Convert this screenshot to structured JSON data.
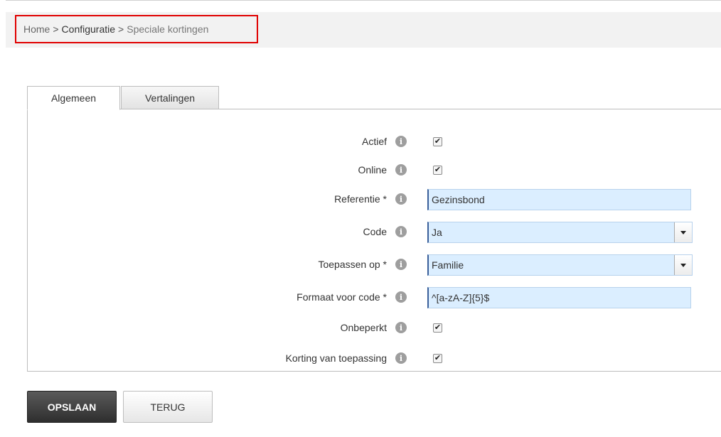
{
  "breadcrumb": {
    "home": "Home",
    "sep1": ">",
    "configuratie": "Configuratie",
    "sep2": ">",
    "current": "Speciale kortingen"
  },
  "tabs": [
    {
      "label": "Algemeen",
      "active": true
    },
    {
      "label": "Vertalingen",
      "active": false
    }
  ],
  "form": {
    "actief": {
      "label": "Actief",
      "checked": true
    },
    "online": {
      "label": "Online",
      "checked": true
    },
    "referentie": {
      "label": "Referentie *",
      "value": "Gezinsbond"
    },
    "code": {
      "label": "Code",
      "value": "Ja"
    },
    "toepassen_op": {
      "label": "Toepassen op *",
      "value": "Familie"
    },
    "formaat": {
      "label": "Formaat voor code *",
      "value": "^[a-zA-Z]{5}$"
    },
    "onbeperkt": {
      "label": "Onbeperkt",
      "checked": true
    },
    "korting": {
      "label": "Korting van toepassing",
      "checked": true
    }
  },
  "icons": {
    "info": "i",
    "check": "✔"
  },
  "buttons": {
    "save": "OPSLAAN",
    "back": "TERUG"
  },
  "colors": {
    "input_bg": "#dbeeff",
    "breadcrumb_highlight": "#e00000",
    "save_button": "#3a3a3a"
  }
}
